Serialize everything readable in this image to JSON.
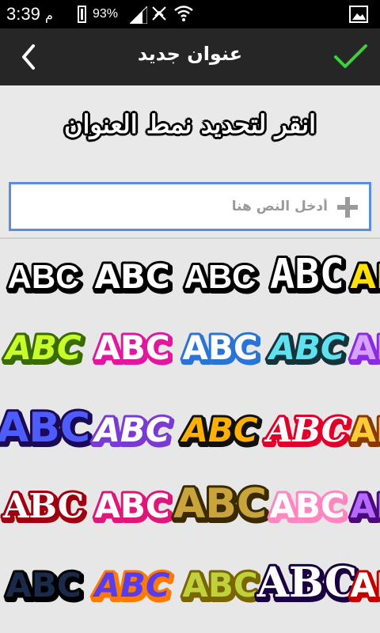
{
  "status_bar": {
    "time": "3:39",
    "time_suffix": "م",
    "battery": "93%"
  },
  "header": {
    "title": "عنوان جديد"
  },
  "prompt": "انقر لتحديد نمط العنوان",
  "input": {
    "placeholder": "أدخل النص هنا",
    "value": ""
  },
  "styles": {
    "sample_text": "ABC",
    "items": [
      {
        "fill": "#ffffff",
        "stroke": "#000000",
        "style": "plain-outline"
      },
      {
        "fill": "#ffffff",
        "stroke": "#000000",
        "style": "rounded-outline"
      },
      {
        "fill": "#ffffff",
        "stroke": "#000000",
        "style": "bold-outline"
      },
      {
        "fill": "#ffffff",
        "stroke": "#000000",
        "style": "condensed-outline"
      },
      {
        "fill": "#ffe000",
        "stroke": "#000000",
        "style": "partial"
      },
      {
        "fill": "#c8ff2a",
        "stroke": "#3a6b00",
        "style": "lime-3d"
      },
      {
        "fill": "#ffffff",
        "stroke": "#e3179f",
        "style": "pink-bubble"
      },
      {
        "fill": "#ffffff",
        "stroke": "#2a74d8",
        "style": "blue-outline"
      },
      {
        "fill": "#5ee2f0",
        "stroke": "#15333b",
        "style": "cyan-dark"
      },
      {
        "fill": "#d6a2ff",
        "stroke": "#8a2be2",
        "style": "violet-partial"
      },
      {
        "fill": "#4e5bff",
        "stroke": "#1b0a55",
        "style": "blue-gradient"
      },
      {
        "fill": "#ffffff",
        "stroke": "#7a3bd4",
        "style": "lavender"
      },
      {
        "fill": "#ffb000",
        "stroke": "#111111",
        "style": "orange-red"
      },
      {
        "fill": "#ffffff",
        "stroke": "#e0002a",
        "style": "white-red-shadow"
      },
      {
        "fill": "#ffcc33",
        "stroke": "#8a3a00",
        "style": "gold-partial"
      },
      {
        "fill": "#ffffff",
        "stroke": "#9e0010",
        "style": "red-brush"
      },
      {
        "fill": "#ffffff",
        "stroke": "#e0177a",
        "style": "pink-mint"
      },
      {
        "fill": "#c9a43a",
        "stroke": "#3b2a00",
        "style": "gold-block"
      },
      {
        "fill": "#ffffff",
        "stroke": "#ff86c0",
        "style": "pink-soft"
      },
      {
        "fill": "#b569ff",
        "stroke": "#4a0a7a",
        "style": "purple-partial"
      },
      {
        "fill": "#1a2a4a",
        "stroke": "#000000",
        "style": "dark-gradient"
      },
      {
        "fill": "#5a3cf0",
        "stroke": "#ff7a00",
        "style": "blue-orange"
      },
      {
        "fill": "#bfd23a",
        "stroke": "#7a6600",
        "style": "olive-3d"
      },
      {
        "fill": "#ffffff",
        "stroke": "#1a0040",
        "style": "gothic-purple"
      },
      {
        "fill": "#ffffff",
        "stroke": "#c40000",
        "style": "red-partial"
      }
    ]
  }
}
